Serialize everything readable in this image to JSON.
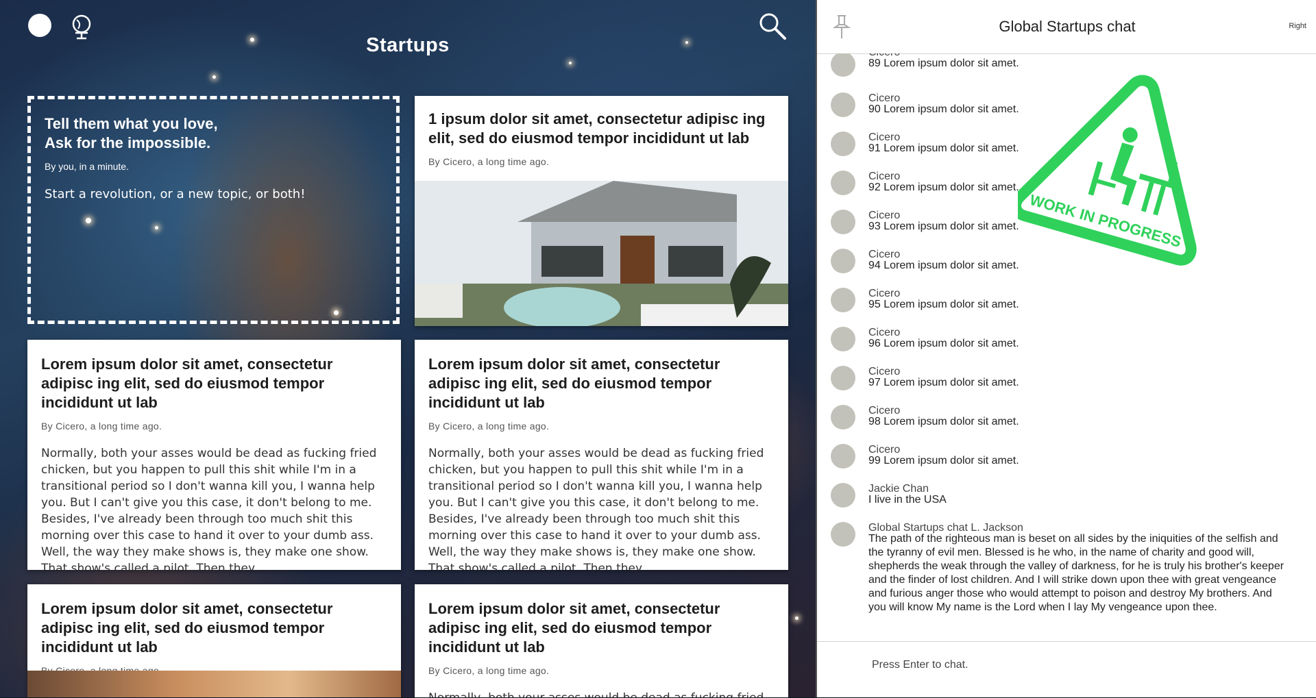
{
  "feed": {
    "title": "Startups",
    "new_topic": {
      "heading_line1": "Tell them what you love,",
      "heading_line2": "Ask for the impossible.",
      "meta": "By you, in a minute.",
      "subtitle": "Start a revolution, or a new topic, or both!"
    },
    "cards": [
      {
        "title": "1 ipsum dolor sit amet, consectetur adipisc ing elit, sed do eiusmod tempor incididunt ut lab",
        "meta": "By Cicero, a long time ago.",
        "body": ""
      },
      {
        "title": "Lorem ipsum dolor sit amet, consectetur adipisc ing elit, sed do eiusmod tempor incididunt ut lab",
        "meta": "By Cicero, a long time ago.",
        "body": "Normally, both your asses would be dead as fucking fried chicken, but you happen to pull this shit while I'm in a transitional period so I don't wanna kill you, I wanna help you. But I can't give you this case, it don't belong to me. Besides, I've already been through too much shit this morning over this case to hand it over to your dumb ass. Well, the way they make shows is, they make one show. That show's called a pilot. Then they"
      },
      {
        "title": "Lorem ipsum dolor sit amet, consectetur adipisc ing elit, sed do eiusmod tempor incididunt ut lab",
        "meta": "By Cicero, a long time ago.",
        "body": "Normally, both your asses would be dead as fucking fried chicken, but you happen to pull this shit while I'm in a transitional period so I don't wanna kill you, I wanna help you. But I can't give you this case, it don't belong to me. Besides, I've already been through too much shit this morning over this case to hand it over to your dumb ass. Well, the way they make shows is, they make one show. That show's called a pilot. Then they"
      },
      {
        "title": "Lorem ipsum dolor sit amet, consectetur adipisc ing elit, sed do eiusmod tempor incididunt ut lab",
        "meta": "By Cicero, a long time ago.",
        "body": ""
      },
      {
        "title": "Lorem ipsum dolor sit amet, consectetur adipisc ing elit, sed do eiusmod tempor incididunt ut lab",
        "meta": "By Cicero, a long time ago.",
        "body": "Normally, both your asses would be dead as fucking fried chicken, but you happen to pull this shit while I'm"
      }
    ]
  },
  "chat": {
    "title": "Global Startups chat",
    "right_label": "Right",
    "messages": [
      {
        "name": "Cicero",
        "text": "89 Lorem ipsum dolor sit amet."
      },
      {
        "name": "Cicero",
        "text": "90 Lorem ipsum dolor sit amet."
      },
      {
        "name": "Cicero",
        "text": "91 Lorem ipsum dolor sit amet."
      },
      {
        "name": "Cicero",
        "text": "92 Lorem ipsum dolor sit amet."
      },
      {
        "name": "Cicero",
        "text": "93 Lorem ipsum dolor sit amet."
      },
      {
        "name": "Cicero",
        "text": "94 Lorem ipsum dolor sit amet."
      },
      {
        "name": "Cicero",
        "text": "95 Lorem ipsum dolor sit amet."
      },
      {
        "name": "Cicero",
        "text": "96 Lorem ipsum dolor sit amet."
      },
      {
        "name": "Cicero",
        "text": "97 Lorem ipsum dolor sit amet."
      },
      {
        "name": "Cicero",
        "text": "98 Lorem ipsum dolor sit amet."
      },
      {
        "name": "Cicero",
        "text": "99 Lorem ipsum dolor sit amet."
      },
      {
        "name": "Jackie Chan",
        "text": "I live in the USA"
      },
      {
        "name": "Global Startups chat L. Jackson",
        "text": "The path of the righteous man is beset on all sides by the iniquities of the selfish and the tyranny of evil men. Blessed is he who, in the name of charity and good will, shepherds the weak through the valley of darkness, for he is truly his brother's keeper and the finder of lost children. And I will strike down upon thee with great vengeance and furious anger those who would attempt to poison and destroy My brothers. And you will know My name is the Lord when I lay My vengeance upon thee."
      }
    ],
    "input_placeholder": "Press Enter to chat."
  },
  "wip_badge": {
    "text": "WORK IN PROGRESS",
    "color": "#2fd15a"
  },
  "icons": {
    "home": "circle-icon",
    "globe": "globe-icon",
    "search": "search-icon",
    "pin": "pin-icon"
  },
  "colors": {
    "accent_green": "#2fd15a",
    "avatar_gray": "#c2c2ba"
  }
}
